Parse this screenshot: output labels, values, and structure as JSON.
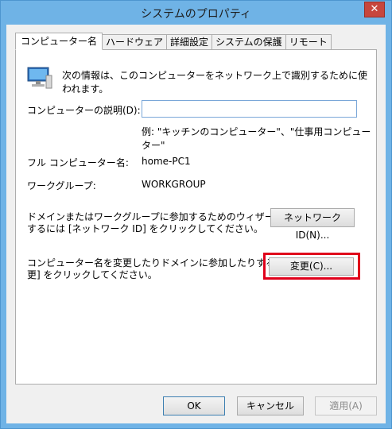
{
  "window": {
    "title": "システムのプロパティ",
    "close": "✕"
  },
  "tabs": [
    {
      "label": "コンピューター名",
      "active": true
    },
    {
      "label": "ハードウェア",
      "active": false
    },
    {
      "label": "詳細設定",
      "active": false
    },
    {
      "label": "システムの保護",
      "active": false
    },
    {
      "label": "リモート",
      "active": false
    }
  ],
  "panel": {
    "intro": "次の情報は、このコンピューターをネットワーク上で識別するために使われます。",
    "description_label": "コンピューターの説明(D):",
    "description_value": "",
    "example": "例: \"キッチンのコンピューター\"、\"仕事用コンピューター\"",
    "fullname_label": "フル コンピューター名:",
    "fullname_value": "home-PC1",
    "workgroup_label": "ワークグループ:",
    "workgroup_value": "WORKGROUP",
    "wizard_text_1": "ドメインまたはワークグループに参加するためのウィザードを使用",
    "wizard_text_2": "するには [ネットワーク ID] をクリックしてください。",
    "network_id_button": "ネットワーク ID(N)...",
    "change_text_1": "コンピューター名を変更したりドメインに参加したりするには [変",
    "change_text_2": "更] をクリックしてください。",
    "change_button": "変更(C)..."
  },
  "footer": {
    "ok": "OK",
    "cancel": "キャンセル",
    "apply": "適用(A)"
  },
  "colors": {
    "titlebar": "#6fb3e6",
    "highlight": "#e0001b",
    "close": "#c7463d"
  },
  "icons": {
    "computer": "computer-icon",
    "close": "close-icon"
  }
}
